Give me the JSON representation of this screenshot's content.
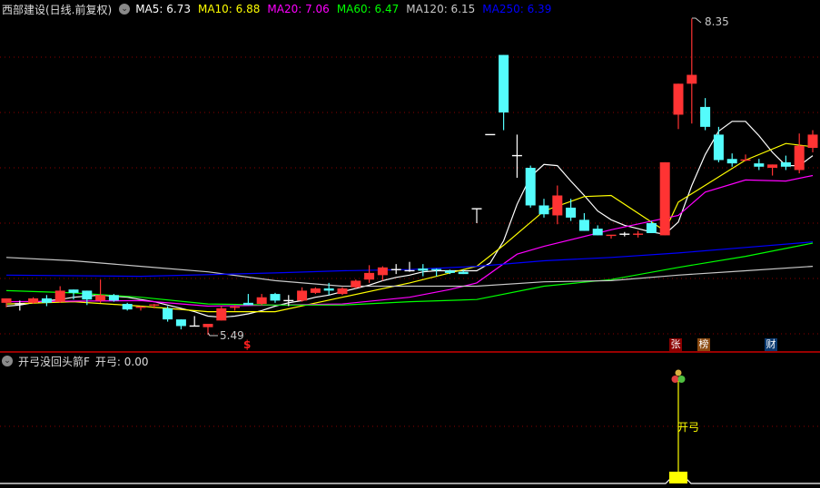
{
  "header": {
    "title": "西部建设(日线.前复权)",
    "ma": [
      {
        "label": "MA5: 6.73",
        "color": "#ffffff"
      },
      {
        "label": "MA10: 6.88",
        "color": "#ffff00"
      },
      {
        "label": "MA20: 7.06",
        "color": "#ff00ff"
      },
      {
        "label": "MA60: 6.47",
        "color": "#00ff00"
      },
      {
        "label": "MA120: 6.15",
        "color": "#c8c8c8"
      },
      {
        "label": "MA250: 6.39",
        "color": "#0000ff"
      }
    ]
  },
  "annotations": {
    "high": "8.35",
    "low": "5.49",
    "dollar": "$"
  },
  "markers": [
    {
      "text": "张",
      "bg": "#8b0000"
    },
    {
      "text": "榜",
      "bg": "#8b4a10"
    },
    {
      "text": "财",
      "bg": "#0b3a70"
    }
  ],
  "sub_panel": {
    "title": "开弓没回头箭F",
    "value_label": "开弓: 0.00",
    "signal_label": "开弓",
    "signal_index": 50
  },
  "colors": {
    "up": "#ff3333",
    "down": "#54fcfc",
    "doji": "#ffffff",
    "grid": "#8b0000",
    "signal": "#ffff00"
  },
  "candles": [
    [
      5.78,
      5.82,
      5.74,
      5.82
    ],
    [
      5.77,
      5.8,
      5.71,
      5.77
    ],
    [
      5.78,
      5.83,
      5.77,
      5.82
    ],
    [
      5.82,
      5.85,
      5.75,
      5.78
    ],
    [
      5.79,
      5.93,
      5.78,
      5.89
    ],
    [
      5.9,
      5.9,
      5.81,
      5.87
    ],
    [
      5.89,
      5.89,
      5.76,
      5.81
    ],
    [
      5.8,
      5.99,
      5.78,
      5.85
    ],
    [
      5.85,
      5.86,
      5.79,
      5.8
    ],
    [
      5.77,
      5.78,
      5.71,
      5.72
    ],
    [
      5.73,
      5.75,
      5.71,
      5.74
    ],
    [
      5.75,
      5.77,
      5.73,
      5.76
    ],
    [
      5.73,
      5.75,
      5.61,
      5.63
    ],
    [
      5.63,
      5.63,
      5.54,
      5.57
    ],
    [
      5.57,
      5.66,
      5.57,
      5.57
    ],
    [
      5.56,
      5.59,
      5.49,
      5.59
    ],
    [
      5.62,
      5.75,
      5.62,
      5.73
    ],
    [
      5.73,
      5.76,
      5.71,
      5.74
    ],
    [
      5.78,
      5.86,
      5.76,
      5.76
    ],
    [
      5.77,
      5.86,
      5.76,
      5.83
    ],
    [
      5.86,
      5.87,
      5.78,
      5.8
    ],
    [
      5.8,
      5.85,
      5.75,
      5.8
    ],
    [
      5.8,
      5.92,
      5.79,
      5.89
    ],
    [
      5.87,
      5.92,
      5.86,
      5.91
    ],
    [
      5.91,
      5.96,
      5.85,
      5.89
    ],
    [
      5.86,
      5.92,
      5.85,
      5.91
    ],
    [
      5.92,
      5.99,
      5.91,
      5.98
    ],
    [
      5.99,
      6.12,
      5.96,
      6.05
    ],
    [
      6.03,
      6.11,
      5.98,
      6.1
    ],
    [
      6.08,
      6.13,
      6.04,
      6.08
    ],
    [
      6.07,
      6.15,
      6.06,
      6.07
    ],
    [
      6.09,
      6.13,
      6.02,
      6.07
    ],
    [
      6.08,
      6.09,
      6.02,
      6.07
    ],
    [
      6.07,
      6.08,
      6.04,
      6.05
    ],
    [
      6.06,
      6.08,
      6.04,
      6.04
    ],
    [
      6.63,
      6.63,
      6.5,
      6.63
    ],
    [
      7.3,
      7.3,
      7.3,
      7.3
    ],
    [
      8.02,
      8.02,
      7.34,
      7.5
    ],
    [
      7.11,
      7.3,
      6.91,
      7.11
    ],
    [
      7.0,
      7.02,
      6.64,
      6.66
    ],
    [
      6.66,
      6.72,
      6.55,
      6.58
    ],
    [
      6.57,
      6.84,
      6.49,
      6.75
    ],
    [
      6.64,
      6.72,
      6.52,
      6.55
    ],
    [
      6.53,
      6.59,
      6.43,
      6.43
    ],
    [
      6.45,
      6.48,
      6.39,
      6.39
    ],
    [
      6.38,
      6.39,
      6.36,
      6.39
    ],
    [
      6.4,
      6.42,
      6.38,
      6.4
    ],
    [
      6.39,
      6.43,
      6.37,
      6.4
    ],
    [
      6.5,
      6.52,
      6.41,
      6.41
    ],
    [
      6.39,
      7.05,
      6.39,
      7.05
    ],
    [
      7.48,
      7.76,
      7.35,
      7.76
    ],
    [
      7.76,
      8.35,
      7.4,
      7.84
    ],
    [
      7.55,
      7.63,
      7.34,
      7.37
    ],
    [
      7.3,
      7.37,
      7.05,
      7.07
    ],
    [
      7.08,
      7.13,
      7.01,
      7.04
    ],
    [
      7.06,
      7.12,
      7.06,
      7.07
    ],
    [
      7.04,
      7.08,
      6.98,
      7.01
    ],
    [
      7.0,
      7.03,
      6.93,
      7.03
    ],
    [
      7.05,
      7.11,
      6.98,
      7.01
    ],
    [
      6.98,
      7.31,
      6.95,
      7.2
    ],
    [
      7.18,
      7.34,
      7.14,
      7.3
    ]
  ],
  "ma_lines": [
    {
      "name": "MA5",
      "color": "#ffffff",
      "idx": [
        0,
        1,
        2,
        3,
        4,
        5,
        6,
        7,
        8,
        9,
        10,
        11,
        12,
        13,
        14,
        15,
        16,
        17,
        18,
        19,
        20,
        21,
        22,
        23,
        24,
        25,
        26,
        27,
        28,
        29,
        30,
        31,
        32,
        33,
        34,
        35,
        36,
        37,
        38,
        39,
        40,
        41,
        42,
        43,
        44,
        45,
        46,
        47,
        48,
        49,
        50,
        51,
        52,
        53,
        54,
        55,
        56,
        57,
        58,
        59,
        60
      ],
      "values": [
        5.75,
        5.76,
        5.78,
        5.8,
        5.81,
        5.83,
        5.84,
        5.85,
        5.84,
        5.83,
        5.81,
        5.79,
        5.76,
        5.73,
        5.7,
        5.66,
        5.65,
        5.66,
        5.68,
        5.71,
        5.75,
        5.78,
        5.8,
        5.83,
        5.85,
        5.88,
        5.91,
        5.94,
        5.98,
        6.01,
        6.03,
        6.06,
        6.07,
        6.07,
        6.07,
        6.07,
        6.14,
        6.34,
        6.67,
        6.92,
        7.03,
        7.02,
        6.88,
        6.75,
        6.61,
        6.53,
        6.48,
        6.45,
        6.42,
        6.4,
        6.51,
        6.84,
        7.12,
        7.33,
        7.42,
        7.42,
        7.29,
        7.14,
        7.02,
        7.02,
        7.11
      ]
    },
    {
      "name": "MA10",
      "color": "#ffff00",
      "idx": [
        0,
        5,
        10,
        15,
        20,
        25,
        30,
        35,
        37,
        40,
        43,
        45,
        48,
        49,
        50,
        55,
        58,
        60
      ],
      "values": [
        5.77,
        5.79,
        5.75,
        5.7,
        5.7,
        5.83,
        5.96,
        6.11,
        6.3,
        6.61,
        6.74,
        6.75,
        6.51,
        6.43,
        6.69,
        7.07,
        7.22,
        7.19
      ]
    },
    {
      "name": "MA20",
      "color": "#ff00ff",
      "idx": [
        0,
        10,
        15,
        20,
        25,
        30,
        33,
        35,
        38,
        40,
        45,
        50,
        52,
        55,
        58,
        60
      ],
      "values": [
        5.79,
        5.8,
        5.75,
        5.76,
        5.77,
        5.83,
        5.9,
        5.96,
        6.22,
        6.29,
        6.44,
        6.57,
        6.78,
        6.89,
        6.88,
        6.93
      ]
    },
    {
      "name": "MA60",
      "color": "#00ff00",
      "idx": [
        0,
        5,
        10,
        15,
        20,
        25,
        30,
        35,
        40,
        45,
        50,
        55,
        60
      ],
      "values": [
        5.89,
        5.87,
        5.83,
        5.77,
        5.76,
        5.76,
        5.79,
        5.81,
        5.93,
        5.99,
        6.1,
        6.2,
        6.32
      ]
    },
    {
      "name": "MA120",
      "color": "#c8c8c8",
      "idx": [
        0,
        5,
        10,
        15,
        20,
        25,
        30,
        35,
        40,
        45,
        50,
        55,
        60
      ],
      "values": [
        6.19,
        6.16,
        6.11,
        6.06,
        5.98,
        5.93,
        5.93,
        5.93,
        5.97,
        5.98,
        6.03,
        6.07,
        6.11
      ]
    },
    {
      "name": "MA250",
      "color": "#0000ff",
      "idx": [
        0,
        10,
        20,
        25,
        30,
        35,
        40,
        45,
        50,
        55,
        60
      ],
      "values": [
        6.03,
        6.02,
        6.05,
        6.07,
        6.08,
        6.11,
        6.16,
        6.19,
        6.23,
        6.28,
        6.33
      ]
    }
  ]
}
